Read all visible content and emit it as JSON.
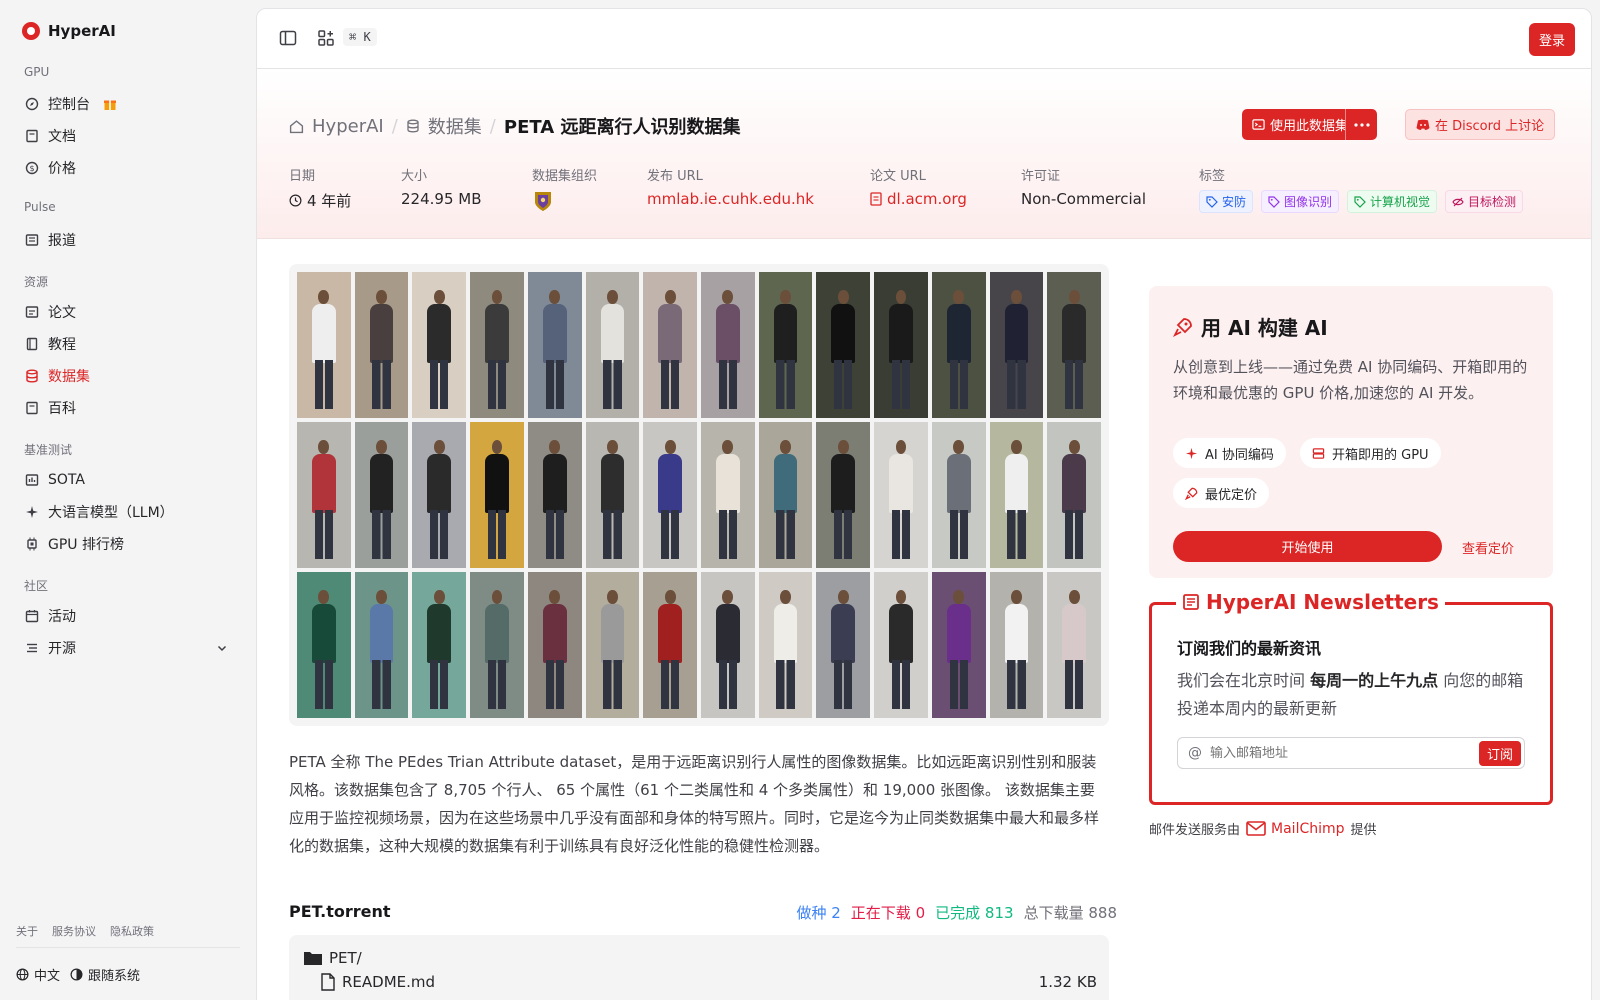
{
  "brand": "HyperAI",
  "sidebar": {
    "sections": [
      {
        "title": "GPU",
        "items": [
          {
            "label": "控制台",
            "icon": "compass-icon"
          },
          {
            "label": "文档",
            "icon": "book-icon"
          },
          {
            "label": "价格",
            "icon": "dollar-icon"
          }
        ]
      },
      {
        "title": "Pulse",
        "items": [
          {
            "label": "报道",
            "icon": "newspaper-icon"
          }
        ]
      },
      {
        "title": "资源",
        "items": [
          {
            "label": "论文",
            "icon": "paper-icon"
          },
          {
            "label": "教程",
            "icon": "notebook-icon"
          },
          {
            "label": "数据集",
            "icon": "database-icon",
            "active": true
          },
          {
            "label": "百科",
            "icon": "book-icon"
          }
        ]
      },
      {
        "title": "基准测试",
        "items": [
          {
            "label": "SOTA",
            "icon": "chart-icon"
          },
          {
            "label": "大语言模型（LLM）",
            "icon": "sparkle-icon"
          },
          {
            "label": "GPU 排行榜",
            "icon": "chip-icon"
          }
        ]
      },
      {
        "title": "社区",
        "items": [
          {
            "label": "活动",
            "icon": "calendar-icon"
          },
          {
            "label": "开源",
            "icon": "list-icon"
          }
        ]
      }
    ],
    "footer_links": [
      "关于",
      "服务协议",
      "隐私政策"
    ],
    "language": "中文",
    "theme": "跟随系统"
  },
  "topbar": {
    "shortcut": "⌘ K",
    "login": "登录"
  },
  "breadcrumb": {
    "home": "HyperAI",
    "section": "数据集",
    "current": "PETA 远距离行人识别数据集"
  },
  "actions": {
    "use_dataset": "使用此数据集",
    "discord": "在 Discord 上讨论"
  },
  "meta": {
    "date_label": "日期",
    "date_value": "4 年前",
    "size_label": "大小",
    "size_value": "224.95 MB",
    "org_label": "数据集组织",
    "publish_label": "发布 URL",
    "publish_value": "mmlab.ie.cuhk.edu.hk",
    "paper_label": "论文 URL",
    "paper_value": "dl.acm.org",
    "license_label": "许可证",
    "license_value": "Non-Commercial",
    "tags_label": "标签",
    "tags": [
      {
        "label": "安防",
        "color": "#2563eb",
        "bg": "#eef2ff"
      },
      {
        "label": "图像识别",
        "color": "#9333ea",
        "bg": "#f5efff"
      },
      {
        "label": "计算机视觉",
        "color": "#16a34a",
        "bg": "#eefbf1"
      },
      {
        "label": "目标检测",
        "color": "#be185d",
        "bg": "#fdf0f5"
      }
    ]
  },
  "description": "PETA 全称 The PEdes Trian Attribute dataset，是用于远距离识别行人属性的图像数据集。比如远距离识别性别和服装风格。该数据集包含了 8,705 个行人、 65 个属性（61 个二类属性和 4 个多类属性）和 19,000 张图像。 该数据集主要应用于监控视频场景，因为在这些场景中几乎没有面部和身体的特写照片。同时，它是迄今为止同类数据集中最大和最多样化的数据集，这种大规模的数据集有利于训练具有良好泛化性能的稳健性检测器。",
  "torrent": {
    "title": "PET.torrent",
    "seeding_label": "做种",
    "seeding": "2",
    "downloading_label": "正在下载",
    "downloading": "0",
    "completed_label": "已完成",
    "completed": "813",
    "total_label": "总下载量",
    "total": "888",
    "folder": "PET/",
    "files": [
      {
        "name": "README.md",
        "size": "1.32 KB"
      }
    ]
  },
  "promo": {
    "title": "用 AI 构建 AI",
    "text": "从创意到上线——通过免费 AI 协同编码、开箱即用的环境和最优惠的 GPU 价格,加速您的 AI 开发。",
    "pill1": "AI 协同编码",
    "pill2": "开箱即用的 GPU",
    "pill3": "最优定价",
    "start": "开始使用",
    "pricing": "查看定价"
  },
  "newsletter": {
    "title": "HyperAI Newsletters",
    "subtitle": "订阅我们的最新资讯",
    "text_pre": "我们会在北京时间 ",
    "text_bold": "每周一的上午九点",
    "text_post": " 向您的邮箱投递本周内的最新更新",
    "placeholder": "输入邮箱地址",
    "button": "订阅",
    "note_pre": "邮件发送服务由",
    "note_brand": "MailChimp",
    "note_post": "提供"
  },
  "colors": {
    "accent": "#dc2626"
  }
}
